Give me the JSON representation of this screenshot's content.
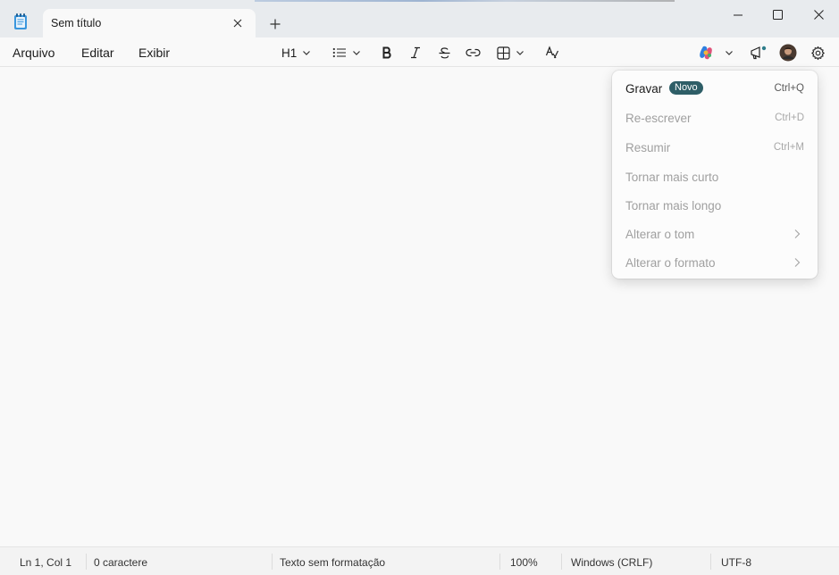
{
  "window": {
    "tab_title": "Sem título",
    "tab_close_icon": "close-icon",
    "new_tab_icon": "plus-icon",
    "controls": [
      "minimize-icon",
      "maximize-icon",
      "close-icon"
    ]
  },
  "menubar": {
    "file": "Arquivo",
    "edit": "Editar",
    "view": "Exibir"
  },
  "toolbar": {
    "heading": "H1",
    "tools": [
      "list-icon",
      "bold-icon",
      "italic-icon",
      "strikethrough-icon",
      "link-icon",
      "table-icon",
      "clear-formatting-icon",
      "copilot-icon",
      "whats-new-icon",
      "avatar",
      "gear-icon"
    ]
  },
  "copilot_menu": {
    "items": [
      {
        "label": "Gravar",
        "badge": "Novo",
        "shortcut": "Ctrl+Q",
        "enabled": true
      },
      {
        "label": "Re-escrever",
        "shortcut": "Ctrl+D",
        "enabled": false
      },
      {
        "label": "Resumir",
        "shortcut": "Ctrl+M",
        "enabled": false
      },
      {
        "label": "Tornar mais curto",
        "enabled": false
      },
      {
        "label": "Tornar mais longo",
        "enabled": false
      },
      {
        "label": "Alterar o tom",
        "submenu": true,
        "enabled": false
      },
      {
        "label": "Alterar o formato",
        "submenu": true,
        "enabled": false
      }
    ]
  },
  "statusbar": {
    "position": "Ln 1, Col 1",
    "chars": "0 caractere",
    "mode": "Texto sem formatação",
    "zoom": "100%",
    "line_endings": "Windows (CRLF)",
    "encoding": "UTF-8"
  },
  "colors": {
    "titlebar": "#e8ebee",
    "badge": "#2e5e67",
    "background": "#f9f9f9"
  }
}
